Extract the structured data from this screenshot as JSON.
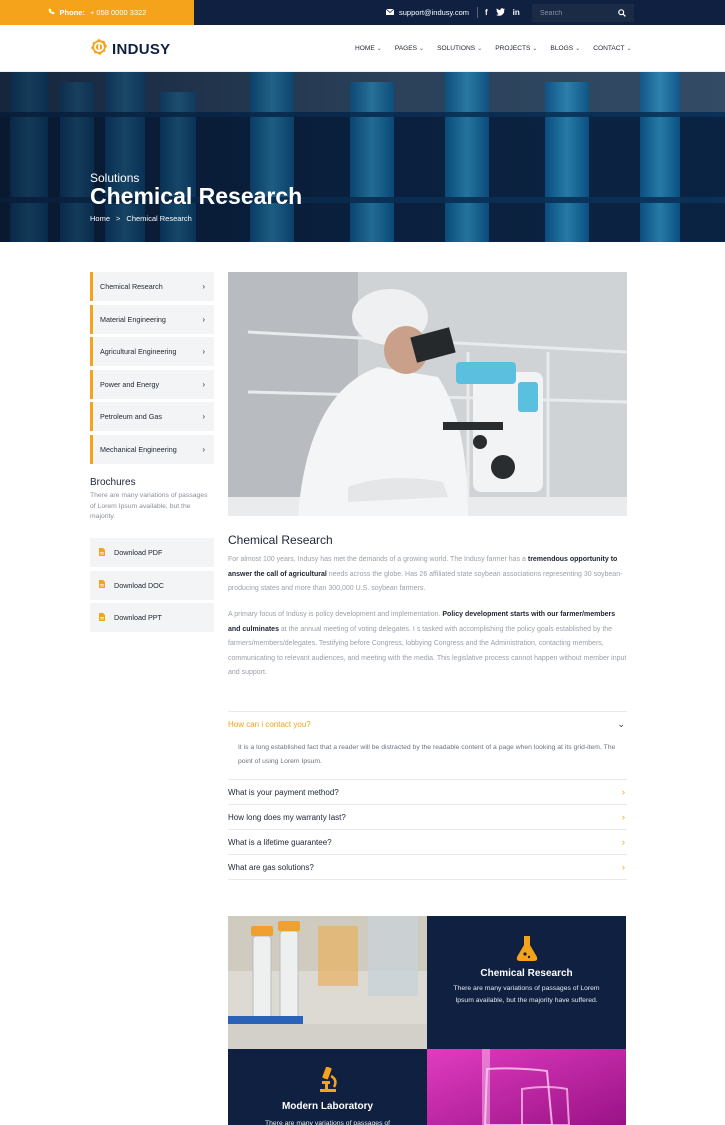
{
  "topbar": {
    "phone_label": "Phone:",
    "phone_number": "+ 058 0000 3322",
    "email": "support@indusy.com",
    "social": [
      "f",
      "t",
      "in"
    ],
    "search_placeholder": "Search"
  },
  "header": {
    "logo_text": "INDUSY",
    "nav": [
      {
        "label": "HOME"
      },
      {
        "label": "PAGES"
      },
      {
        "label": "SOLUTIONS"
      },
      {
        "label": "PROJECTS"
      },
      {
        "label": "BLOGS"
      },
      {
        "label": "CONTACT"
      }
    ]
  },
  "hero": {
    "subtitle": "Solutions",
    "title": "Chemical Research",
    "breadcrumb": {
      "home": "Home",
      "sep": ">",
      "current": "Chemical Research"
    }
  },
  "sidebar": {
    "items": [
      {
        "label": "Chemical Research"
      },
      {
        "label": "Material Engineering"
      },
      {
        "label": "Agricultural Engineering"
      },
      {
        "label": "Power and Energy"
      },
      {
        "label": "Petroleum and Gas"
      },
      {
        "label": "Mechanical Engineering"
      }
    ],
    "brochures_title": "Brochures",
    "brochures_text": "There are many variations of passages of Lorem Ipsum available, but the majority.",
    "downloads": [
      {
        "label": "Download PDF"
      },
      {
        "label": "Download DOC"
      },
      {
        "label": "Download PPT"
      }
    ]
  },
  "main": {
    "heading": "Chemical Research",
    "p1_a": "For almost 100 years, Indusy has met the demands of a growing world. The Indusy farmer has a ",
    "p1_b": "tremendous opportunity to answer the call of agricultural",
    "p1_c": " needs across the globe. Has 26 affiliated state soybean associations representing 30 soybean-producing states and more than 300,000 U.S. soybean farmers.",
    "p2_a": "A primary focus of Indusy is policy development and implementation. ",
    "p2_b": "Policy development starts with our farmer/members and culminates",
    "p2_c": " at the annual meeting of voting delegates. I s tasked with accomplishing the policy goals established by the farmers/members/delegates. Testifying before Congress, lobbying Congress and the Administration, contacting members, communicating to relevant audiences, and meeting with the media. This legislative process cannot happen without member input and support."
  },
  "faq": [
    {
      "question": "How can i contact you?",
      "answer": "It is a long established fact that a reader will be distracted by the readable content of a page when looking at its grid-item. The point of using Lorem Ipsum.",
      "open": true
    },
    {
      "question": "What is your payment method?",
      "open": false
    },
    {
      "question": "How long does my warranty last?",
      "open": false
    },
    {
      "question": "What is a lifetime guarantee?",
      "open": false
    },
    {
      "question": "What are gas solutions?",
      "open": false
    }
  ],
  "cards": [
    {
      "title": "Chemical Research",
      "text": "There are many variations of passages of Lorem Ipsum available, but the majority have suffered."
    },
    {
      "title": "Modern Laboratory",
      "text": "There are many variations of passages of"
    }
  ],
  "colors": {
    "accent": "#f5a31a",
    "navy": "#0f2040",
    "magenta": "#c81ea0"
  }
}
